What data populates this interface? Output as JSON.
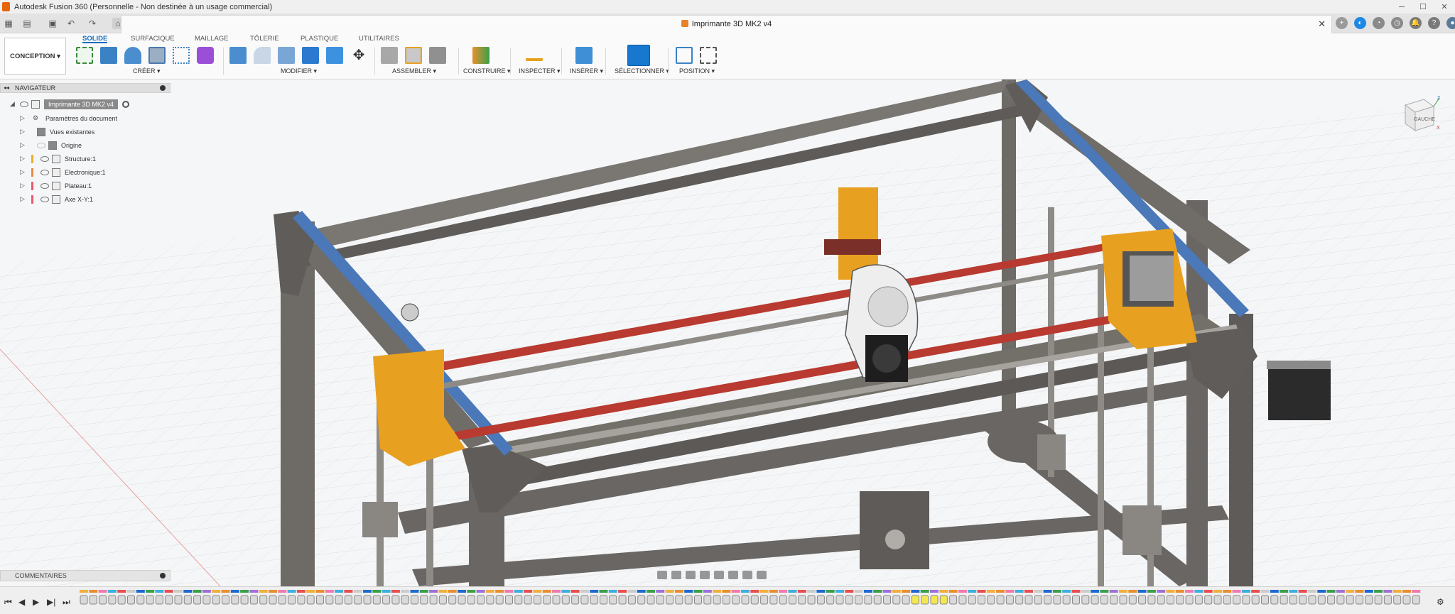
{
  "window": {
    "title": "Autodesk Fusion 360 (Personnelle - Non destinée à un usage commercial)"
  },
  "document": {
    "tab_title": "Imprimante 3D MK2 v4"
  },
  "ribbon": {
    "workspace": "CONCEPTION ▾",
    "tabs": [
      "SOLIDE",
      "SURFACIQUE",
      "MAILLAGE",
      "TÔLERIE",
      "PLASTIQUE",
      "UTILITAIRES"
    ],
    "groups": [
      "CRÉER ▾",
      "MODIFIER ▾",
      "ASSEMBLER ▾",
      "CONSTRUIRE ▾",
      "INSPECTER ▾",
      "INSÉRER ▾",
      "SÉLECTIONNER ▾",
      "POSITION ▾"
    ]
  },
  "navigator": {
    "header": "NAVIGATEUR",
    "root": "Imprimante 3D MK2 v4",
    "items": [
      {
        "label": "Paramètres du document",
        "color": "#888888"
      },
      {
        "label": "Vues existantes",
        "color": "#888888"
      },
      {
        "label": "Origine",
        "color": "#888888"
      },
      {
        "label": "Structure:1",
        "color": "#e8b030"
      },
      {
        "label": "Electronique:1",
        "color": "#e88a40"
      },
      {
        "label": "Plateau:1",
        "color": "#e85a70"
      },
      {
        "label": "Axe X-Y:1",
        "color": "#e85a70"
      }
    ]
  },
  "comments": {
    "label": "COMMENTAIRES"
  },
  "viewcube": {
    "face": "GAUCHE",
    "axis_z": "Z",
    "axis_x": "X"
  },
  "colors": {
    "accent": "#0f6cbd",
    "frame": "#6e6a66",
    "bracket": "#e8a020",
    "rod_red": "#b83a30",
    "belt_blue": "#4a78b8"
  }
}
